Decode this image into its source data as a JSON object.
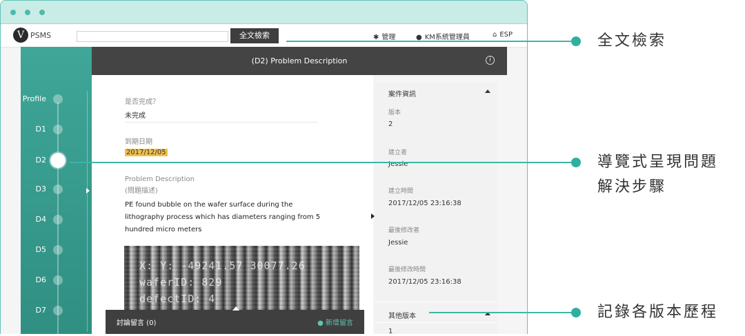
{
  "window": {
    "frame_color": "#5fc3b6",
    "titlebar_color": "#c9ece7"
  },
  "navbar": {
    "brand_letter": "V",
    "brand_name": "PSMS",
    "search_placeholder": "",
    "search_button": "全文檢索",
    "manage_label": "管理",
    "manage_icon": "gear-icon",
    "user_label": "KM系統管理員",
    "user_icon": "user-icon",
    "home_label": "ESP",
    "home_icon": "home-icon"
  },
  "steps": {
    "items": [
      {
        "label": "Profile"
      },
      {
        "label": "D1"
      },
      {
        "label": "D2",
        "active": true
      },
      {
        "label": "D3"
      },
      {
        "label": "D4"
      },
      {
        "label": "D5"
      },
      {
        "label": "D6"
      },
      {
        "label": "D7"
      }
    ],
    "accent": "#3fa698"
  },
  "header": {
    "title": "(D2) Problem Description",
    "info_icon": "info-icon"
  },
  "form": {
    "completed_label": "是否完成？",
    "completed_value": "未完成",
    "due_label": "到期日期",
    "due_value": "2017/12/05",
    "desc_label": "Problem Description",
    "desc_label_zh": "(問題描述)",
    "desc_text": "PE found bubble on the wafer surface during the lithography process which has diameters ranging from 5 hundred micro meters",
    "image_lines": [
      "X: Y: -49241.57  30077.26",
      "waferID: 829",
      "defectID: 4"
    ]
  },
  "comments": {
    "label": "討論留言 (0)",
    "add_label": "新增留言",
    "add_icon": "chat-icon"
  },
  "info_panel": {
    "section_title": "案件資訊",
    "version_label": "版本",
    "version_value": "2",
    "creator_label": "建立者",
    "creator_value": "Jessie",
    "created_label": "建立時間",
    "created_value": "2017/12/05 23:16:38",
    "modifier_label": "最後修改者",
    "modifier_value": "Jessie",
    "modified_label": "最後修改時間",
    "modified_value": "2017/12/05 23:16:38",
    "other_versions_title": "其他版本",
    "other_version_first": "1"
  },
  "callouts": [
    {
      "line1": "全文檢索",
      "line2": ""
    },
    {
      "line1": "導覽式呈現問題",
      "line2": "解決步驟"
    },
    {
      "line1": "記錄各版本歷程",
      "line2": ""
    }
  ],
  "callout_color": "#2eb0a0"
}
